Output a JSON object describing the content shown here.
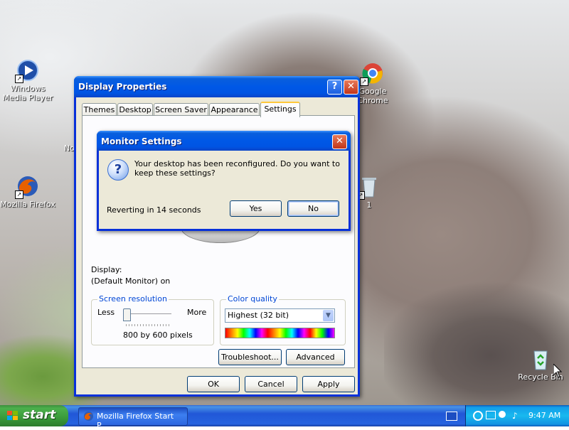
{
  "desktop": {
    "icons": [
      {
        "label": "Windows Media Player",
        "icon": "windows-media-player-icon"
      },
      {
        "label": "Mozilla Firefox",
        "icon": "firefox-icon"
      },
      {
        "label": "Google Chrome",
        "icon": "chrome-icon"
      },
      {
        "label": "1",
        "icon": "recycle-bin-icon"
      },
      {
        "label": "Recycle Bin",
        "icon": "recycle-bin-icon"
      }
    ],
    "partial_label": "No"
  },
  "display_properties": {
    "title": "Display Properties",
    "tabs": [
      "Themes",
      "Desktop",
      "Screen Saver",
      "Appearance",
      "Settings"
    ],
    "active_tab": "Settings",
    "display_label": "Display:",
    "display_value": "(Default Monitor) on",
    "screen_resolution": {
      "title": "Screen resolution",
      "less": "Less",
      "more": "More",
      "value": "800 by 600 pixels",
      "slider_position": 0
    },
    "color_quality": {
      "title": "Color quality",
      "selected": "Highest (32 bit)"
    },
    "buttons": {
      "troubleshoot": "Troubleshoot...",
      "advanced": "Advanced",
      "ok": "OK",
      "cancel": "Cancel",
      "apply": "Apply"
    }
  },
  "monitor_settings": {
    "title": "Monitor Settings",
    "message": "Your desktop has been reconfigured.  Do you want to keep these settings?",
    "countdown": "Reverting in 14 seconds",
    "yes": "Yes",
    "no": "No"
  },
  "taskbar": {
    "start_label": "start",
    "task_label": "Mozilla Firefox Start P...",
    "clock": "9:47 AM"
  },
  "colors": {
    "title_blue": "#0054e3",
    "start_green": "#3a9a3a",
    "dialog_face": "#ece9d8",
    "group_title": "#0046d5"
  }
}
